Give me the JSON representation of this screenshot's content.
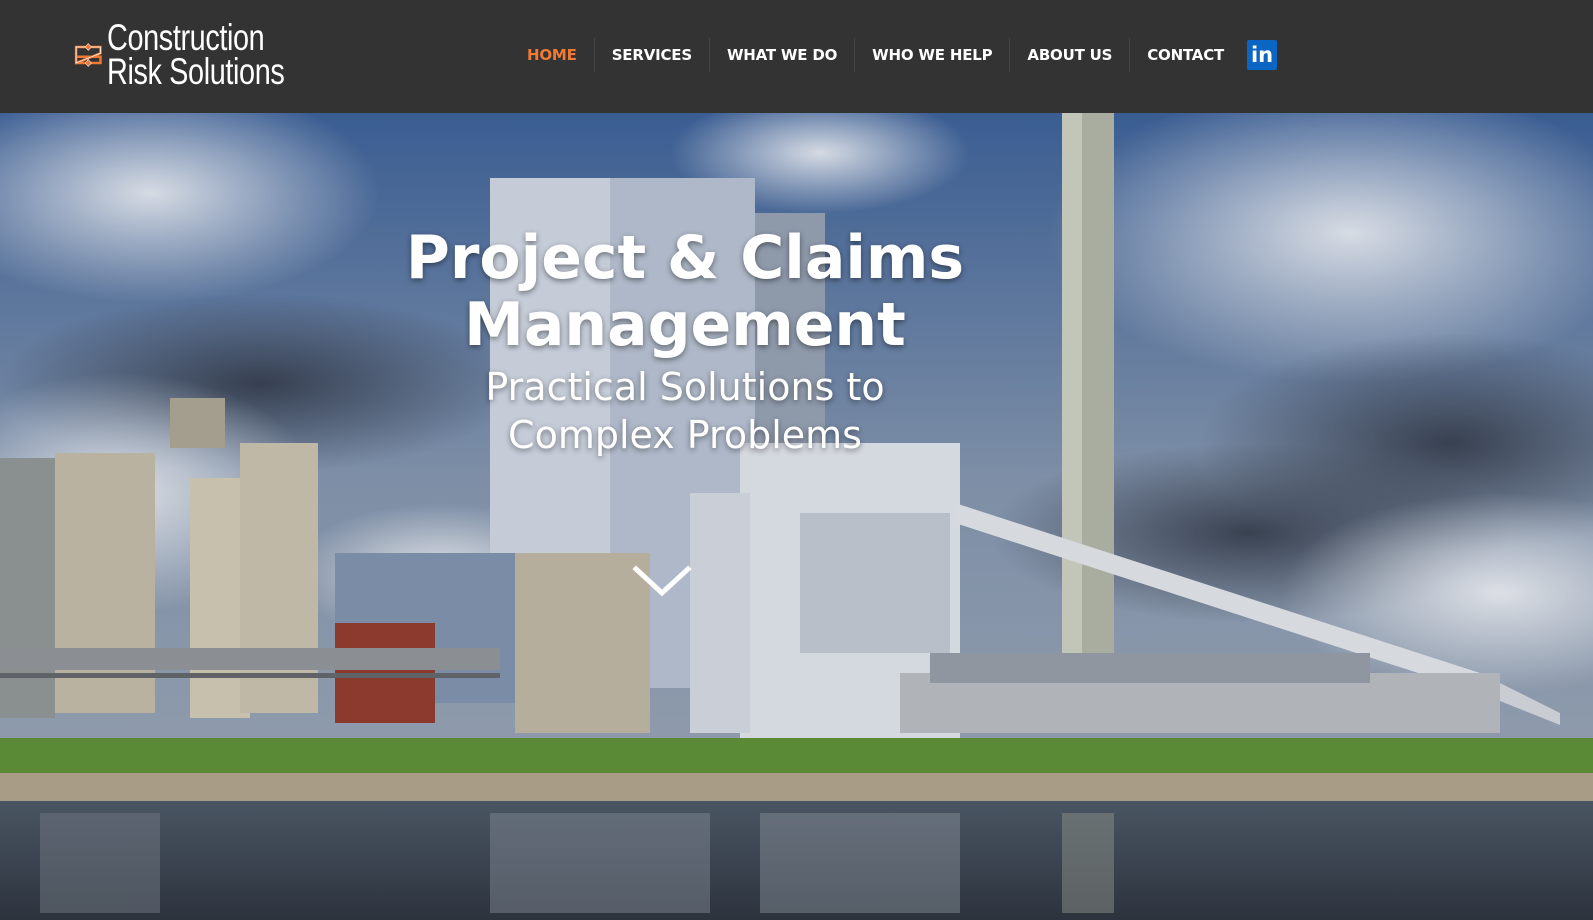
{
  "brand": {
    "line1": "Construction",
    "line2": "Risk Solutions",
    "accent_color": "#ef7a35"
  },
  "nav": {
    "items": [
      {
        "label": "HOME",
        "active": true
      },
      {
        "label": "SERVICES"
      },
      {
        "label": "WHAT WE DO"
      },
      {
        "label": "WHO WE HELP"
      },
      {
        "label": "ABOUT US"
      },
      {
        "label": "CONTACT"
      }
    ],
    "linkedin_label": "in",
    "linkedin_color": "#0a66c2"
  },
  "hero": {
    "title_line1": "Project & Claims",
    "title_line2": "Management",
    "subtitle_line1": "Practical Solutions to",
    "subtitle_line2": "Complex Problems",
    "scroll_icon": "chevron-down-icon"
  }
}
